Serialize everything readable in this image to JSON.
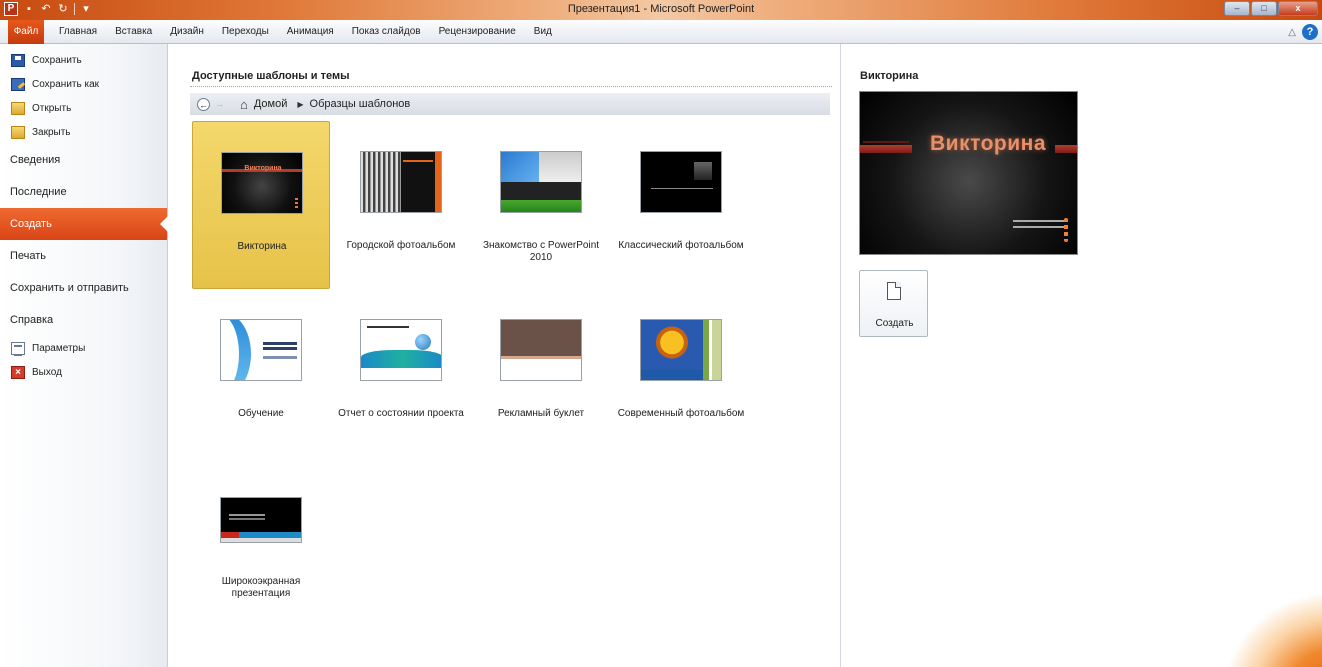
{
  "window": {
    "title": "Презентация1 - Microsoft PowerPoint",
    "app_letter": "P"
  },
  "controls": {
    "minimize": "–",
    "maximize": "□",
    "close": "x"
  },
  "ribbon": {
    "tabs": [
      "Файл",
      "Главная",
      "Вставка",
      "Дизайн",
      "Переходы",
      "Анимация",
      "Показ слайдов",
      "Рецензирование",
      "Вид"
    ],
    "help": "?"
  },
  "sidebar": {
    "commands": [
      "Сохранить",
      "Сохранить как",
      "Открыть",
      "Закрыть"
    ],
    "sections": [
      "Сведения",
      "Последние",
      "Создать",
      "Печать",
      "Сохранить и отправить",
      "Справка"
    ],
    "active": "Создать",
    "bottom": [
      "Параметры",
      "Выход"
    ]
  },
  "main": {
    "title": "Доступные шаблоны и темы",
    "breadcrumb": [
      "Домой",
      "Образцы шаблонов"
    ],
    "templates": [
      "Викторина",
      "Городской фотоальбом",
      "Знакомство с PowerPoint 2010",
      "Классический фотоальбом",
      "Обучение",
      "Отчет о состоянии проекта",
      "Рекламный буклет",
      "Современный фотоальбом",
      "Широкоэкранная презентация"
    ],
    "selected": "Викторина"
  },
  "preview": {
    "title": "Викторина",
    "slide_title": "Викторина",
    "create_label": "Создать"
  }
}
